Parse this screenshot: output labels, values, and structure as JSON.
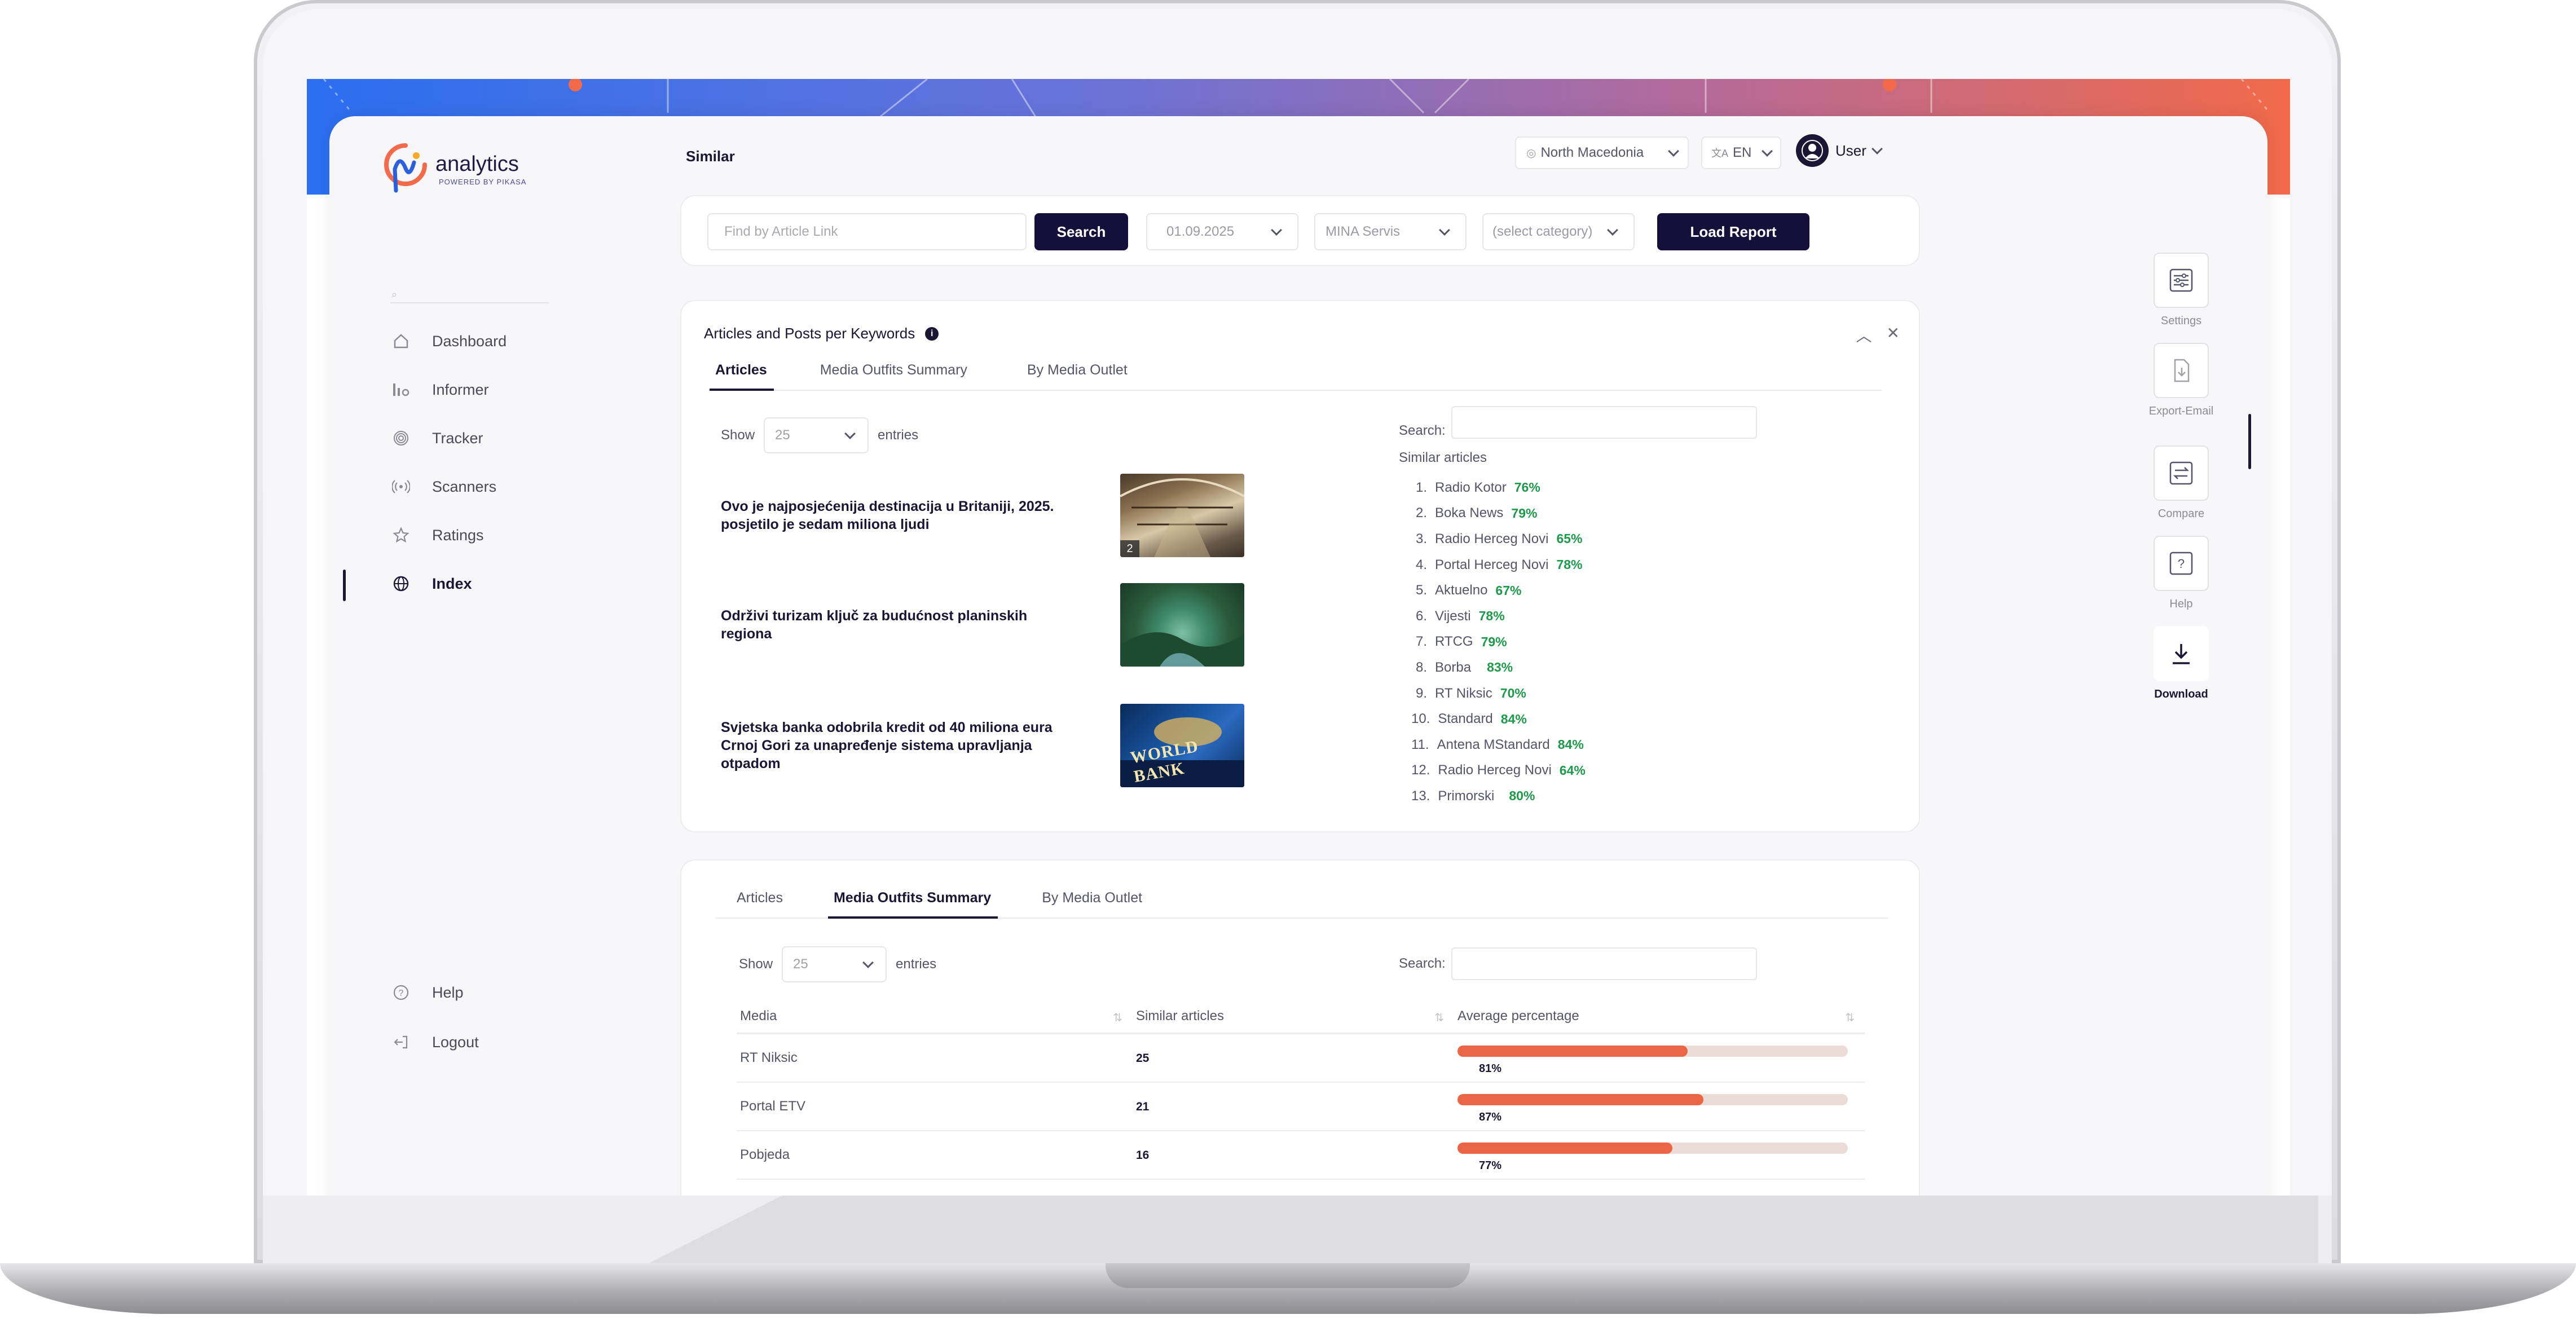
{
  "app": {
    "brand": "analytics",
    "brand_sub": "POWERED BY PIKASA",
    "page_title": "Similar"
  },
  "colors": {
    "primary": "#15103a",
    "accent": "#ea6446",
    "positive": "#1e9a4a",
    "hero_gradient": [
      "#2b6ff0",
      "#b46a9a",
      "#f26a4a"
    ]
  },
  "sidebar": {
    "items": [
      {
        "label": "Dashboard",
        "icon": "home-icon"
      },
      {
        "label": "Informer",
        "icon": "bar-chart-icon"
      },
      {
        "label": "Tracker",
        "icon": "fingerprint-icon"
      },
      {
        "label": "Scanners",
        "icon": "radio-waves-icon"
      },
      {
        "label": "Ratings",
        "icon": "star-icon"
      },
      {
        "label": "Index",
        "icon": "globe-icon",
        "active": true
      }
    ],
    "bottom": [
      {
        "label": "Help",
        "icon": "help-circle-icon"
      },
      {
        "label": "Logout",
        "icon": "logout-icon"
      }
    ]
  },
  "topbar": {
    "country": "North Macedonia",
    "language": "EN",
    "user": "User"
  },
  "filters": {
    "link_placeholder": "Find by Article Link",
    "search_label": "Search",
    "date": "01.09.2025",
    "source": "MINA Servis",
    "category": "(select category)",
    "load_label": "Load Report"
  },
  "panel1": {
    "title": "Articles and Posts per Keywords",
    "tabs": [
      "Articles",
      "Media Outfits Summary",
      "By Media Outlet"
    ],
    "active_tab": 0,
    "show_label": "Show",
    "entries_value": "25",
    "entries_label": "entries",
    "search_label": "Search:",
    "similar_header": "Similar articles",
    "articles": [
      {
        "title": "Ovo je najposjećenija destinacija u Britaniji, 2025. posjetilo je sedam miliona ljudi",
        "image_count": "2",
        "thumb": "museum-hall-photo"
      },
      {
        "title": "Održivi turizam ključ za budućnost planinskih regiona",
        "thumb": "green-valley-photo"
      },
      {
        "title": "Svjetska banka odobrila kredit od 40 miliona eura Crnoj Gori za unapređenje sistema upravljanja otpadom",
        "thumb": "world-bank-sign-photo",
        "thumb_text": "WORLD BANK"
      }
    ],
    "similar": [
      {
        "n": "1.",
        "name": "Radio Kotor",
        "pct": "76%"
      },
      {
        "n": "2.",
        "name": "Boka News",
        "pct": "79%"
      },
      {
        "n": "3.",
        "name": "Radio Herceg Novi",
        "pct": "65%"
      },
      {
        "n": "4.",
        "name": "Portal Herceg Novi",
        "pct": "78%"
      },
      {
        "n": "5.",
        "name": "Aktuelno",
        "pct": "67%"
      },
      {
        "n": "6.",
        "name": "Vijesti",
        "pct": "78%"
      },
      {
        "n": "7.",
        "name": "RTCG",
        "pct": "79%"
      },
      {
        "n": "8.",
        "name": "Borba",
        "pct": "83%"
      },
      {
        "n": "9.",
        "name": "RT Niksic",
        "pct": "70%"
      },
      {
        "n": "10.",
        "name": "Standard",
        "pct": "84%"
      },
      {
        "n": "11.",
        "name": "Antena MStandard",
        "pct": "84%"
      },
      {
        "n": "12.",
        "name": "Radio Herceg Novi",
        "pct": "64%"
      },
      {
        "n": "13.",
        "name": "Primorski",
        "pct": "80%"
      }
    ]
  },
  "panel2": {
    "tabs": [
      "Articles",
      "Media Outfits Summary",
      "By Media Outlet"
    ],
    "active_tab": 1,
    "show_label": "Show",
    "entries_value": "25",
    "entries_label": "entries",
    "search_label": "Search:",
    "columns": [
      "Media",
      "Similar articles",
      "Average percentage"
    ],
    "rows": [
      {
        "media": "RT Niksic",
        "count": "25",
        "avg": "81%",
        "fill": 0.59
      },
      {
        "media": "Portal ETV",
        "count": "21",
        "avg": "87%",
        "fill": 0.63
      },
      {
        "media": "Pobjeda",
        "count": "16",
        "avg": "77%",
        "fill": 0.55
      }
    ]
  },
  "rail": [
    {
      "label": "Settings",
      "icon": "sliders-icon"
    },
    {
      "label": "Export-Email",
      "icon": "file-download-icon"
    },
    {
      "label": "Compare",
      "icon": "swap-icon"
    },
    {
      "label": "Help",
      "icon": "question-box-icon"
    },
    {
      "label": "Download",
      "icon": "download-icon",
      "primary": true
    }
  ]
}
